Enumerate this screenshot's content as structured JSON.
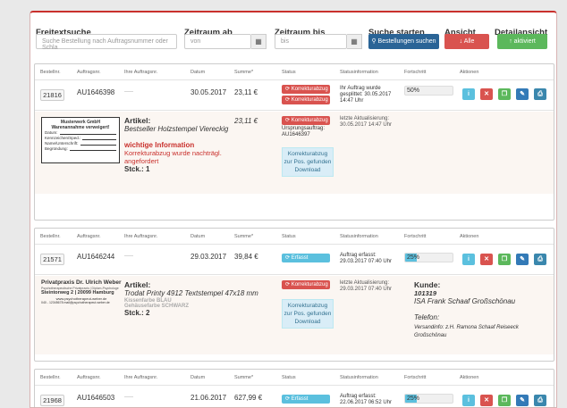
{
  "filters": {
    "freitext_label": "Freitextsuche",
    "freitext_placeholder": "Suche Bestellung nach Auftragsnummer oder Schla",
    "zeitraum_ab_label": "Zeitraum ab",
    "zeitraum_ab_placeholder": "von",
    "zeitraum_bis_label": "Zeitraum bis",
    "zeitraum_bis_placeholder": "bis",
    "suche_label": "Suche starten",
    "suche_button": "Bestellungen suchen",
    "ansicht_label": "Ansicht",
    "ansicht_button": "Alle",
    "detail_label": "Detailansicht",
    "detail_button": "aktiviert"
  },
  "columns": [
    "Bestellnr.",
    "Auftragsnr.",
    "Ihre Auftragsnr.",
    "Datum",
    "Summe*",
    "Status",
    "Statusinformation",
    "Fortschritt",
    "Aktionen"
  ],
  "orders": [
    {
      "bestellnr": "21816",
      "auftragsnr": "AU1646398",
      "ihre": "-----",
      "datum": "30.05.2017",
      "summe": "23,11 €",
      "status_lines": [
        "Korrekturabzug",
        "Korrekturabzug"
      ],
      "status_color": "red",
      "statusinfo": "Ihr Auftrag wurde gesplittet: 30.05.2017 14:47 Uhr",
      "progress_label": "50%",
      "progress_value": 0,
      "detail": {
        "stamp_company": "Musterwerk GmbH",
        "stamp_subtitle": "Warenannahme verweigert!",
        "stamp_fields": [
          "Datum:",
          "Kennzeichen/Sped.:",
          "Name/Unterschrift:",
          "Begründung:"
        ],
        "article_label": "Artikel:",
        "article_name": "Bestseller Holzstempel Viereckig",
        "warning_title": "wichtige Information",
        "warning_text": "Korrekturabzug wurde nachträgl. angefordert",
        "stk": "Stck.: 1",
        "price": "23,11 €",
        "status": "Korrekturabzug",
        "ursprung": "Ursprungsauftrag: AU1646397",
        "download": "Korrekturabzug zur Pos. gefunden Download",
        "last_update": "letzte Aktualisierung: 30.05.2017 14:47 Uhr"
      }
    },
    {
      "bestellnr": "21571",
      "auftragsnr": "AU1646244",
      "ihre": "-----",
      "datum": "29.03.2017",
      "summe": "39,84 €",
      "status_lines": [
        "Erfasst"
      ],
      "status_color": "blue",
      "statusinfo": "Auftrag erfasst: 29.03.2017 07:40 Uhr",
      "progress_label": "25%",
      "progress_value": 0.25,
      "detail": {
        "logo_name": "Privatpraxis Dr. Ulrich Weber",
        "logo_tag": "Psychotherapeutische Privatpraxis | Diplom-Psychologe",
        "logo_address": "Steintorweg 2 | 20099 Hamburg",
        "logo_web": "www.psychotherapeut-weber.de",
        "logo_contact": "040 - 12345678   mail@psychotherapeut-weber.de",
        "article_label": "Artikel:",
        "article_name": "Trodat Printy 4912 Textstempel 47x18 mm",
        "kissenfarbe": "Kissenfarbe BLAU",
        "gehaeusefarbe": "Gehäusefarbe SCHWARZ",
        "stk": "Stck.: 2",
        "status": "Korrekturabzug",
        "download": "Korrekturabzug zur Pos. gefunden Download",
        "last_update": "letzte Aktualisierung: 29.03.2017 07:40 Uhr",
        "kunde_label": "Kunde:",
        "kunde_nr": "101319",
        "kunde_name": "ISA Frank Schaaf Großschönau",
        "telefon": "Telefon:",
        "versandinfo": "Versandinfo: z.H. Ramona Schaaf Reiseeck Großschönau"
      }
    },
    {
      "bestellnr": "21968",
      "auftragsnr": "AU1646503",
      "ihre": "-----",
      "datum": "21.06.2017",
      "summe": "627,99 €",
      "status_lines": [
        "Erfasst"
      ],
      "status_color": "blue",
      "statusinfo": "Auftrag erfasst: 22.06.2017 06:52 Uhr",
      "progress_label": "25%",
      "progress_value": 0.25
    }
  ],
  "colors": {
    "red": "#d9534f",
    "blue": "#5bc0de",
    "green": "#5cb85c",
    "navy": "#337ab7",
    "dark_blue": "#2a6496"
  },
  "action_icons": [
    "info-icon",
    "cancel-icon",
    "copy-icon",
    "edit-icon",
    "print-icon"
  ],
  "action_glyphs": [
    "i",
    "✕",
    "❐",
    "✎",
    "⎙"
  ]
}
